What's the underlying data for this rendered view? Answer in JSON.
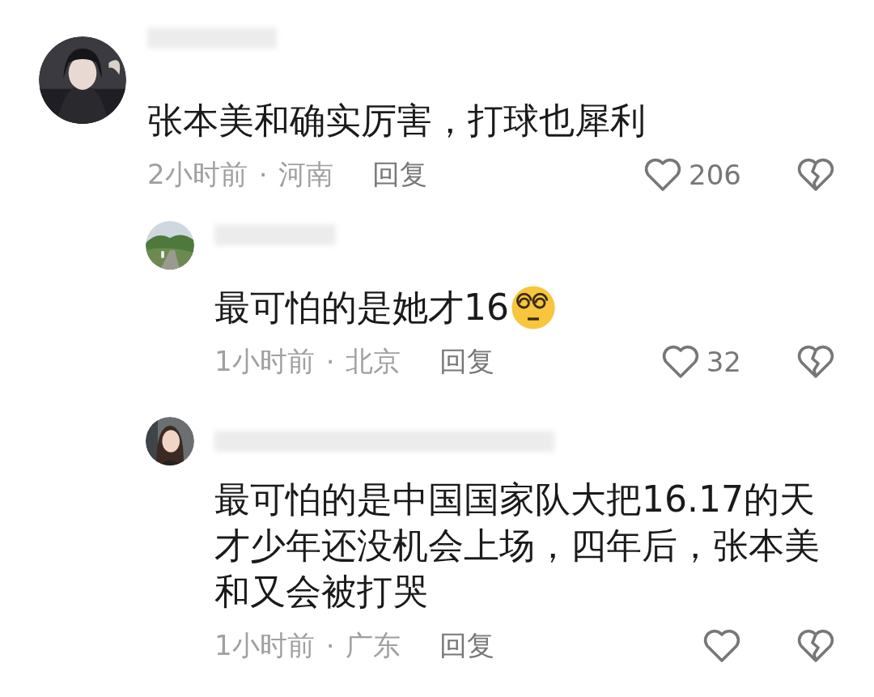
{
  "comments": [
    {
      "text": "张本美和确实厉害，打球也犀利",
      "time": "2小时前",
      "separator": "·",
      "location": "河南",
      "reply_label": "回复",
      "likes": "206",
      "children": [
        {
          "text": "最可怕的是她才16",
          "emoji": true,
          "time": "1小时前",
          "separator": "·",
          "location": "北京",
          "reply_label": "回复",
          "likes": "32"
        },
        {
          "text": "最可怕的是中国国家队大把16.17的天才少年还没机会上场，四年后，张本美和又会被打哭",
          "emoji": false,
          "time": "1小时前",
          "separator": "·",
          "location": "广东",
          "reply_label": "回复"
        }
      ]
    }
  ]
}
